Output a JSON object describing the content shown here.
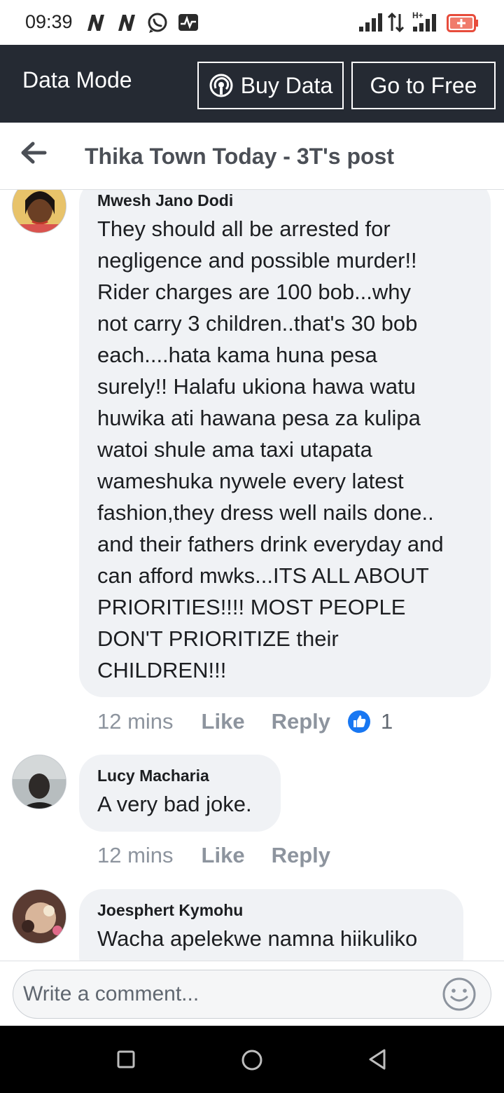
{
  "status_bar": {
    "time": "09:39",
    "notification_icons": [
      "n-icon",
      "n-icon",
      "whatsapp-icon",
      "activity-icon"
    ],
    "system_icons": [
      "signal-icon",
      "data-transfer-icon",
      "h-plus-signal-icon",
      "battery-icon"
    ]
  },
  "data_mode": {
    "title": "Data Mode",
    "buy_data_label": "Buy Data",
    "go_free_label": "Go to Free"
  },
  "header": {
    "title": "Thika Town Today - 3T's post"
  },
  "comments": [
    {
      "author": "Mwesh Jano Dodi",
      "lines": [
        "They should all be arrested for",
        "negligence and possible murder!!",
        "Rider charges are 100 bob...why",
        "not carry 3 children..that's 30 bob",
        "each....hata kama huna pesa",
        "surely!! Halafu ukiona hawa watu",
        "huwika ati hawana pesa za kulipa",
        "watoi shule ama taxi utapata",
        "wameshuka nywele every latest",
        "fashion,they dress well nails done..",
        "and their fathers drink everyday and",
        "can afford mwks...ITS ALL ABOUT",
        "PRIORITIES!!!! MOST PEOPLE",
        "DON'T PRIORITIZE their",
        "CHILDREN!!!"
      ],
      "time": "12 mins",
      "like_label": "Like",
      "reply_label": "Reply",
      "reaction_count": "1"
    },
    {
      "author": "Lucy Macharia",
      "lines": [
        "A very bad joke."
      ],
      "time": "12 mins",
      "like_label": "Like",
      "reply_label": "Reply"
    },
    {
      "author": "Joesphert Kymohu",
      "lines": [
        "Wacha apelekwe namna hiikuliko"
      ]
    }
  ],
  "composer": {
    "placeholder": "Write a comment..."
  },
  "colors": {
    "data_mode_bg": "#252a33",
    "bubble_bg": "#f0f2f5",
    "meta_text": "#8d949e",
    "like_blue": "#1877f2"
  }
}
